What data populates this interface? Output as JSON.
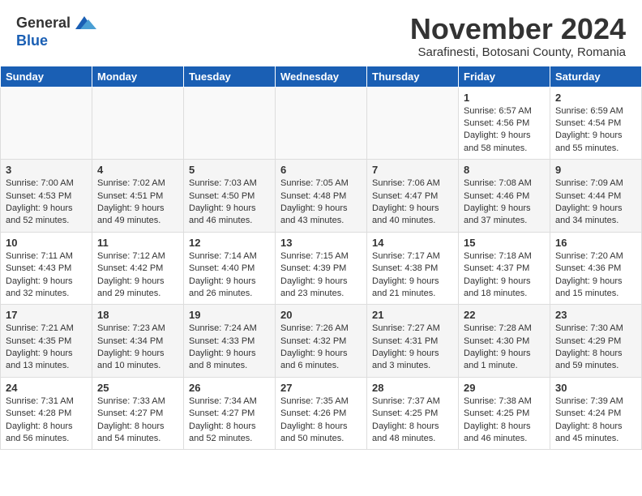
{
  "header": {
    "logo": {
      "general": "General",
      "blue": "Blue"
    },
    "title": "November 2024",
    "location": "Sarafinesti, Botosani County, Romania"
  },
  "calendar": {
    "days_of_week": [
      "Sunday",
      "Monday",
      "Tuesday",
      "Wednesday",
      "Thursday",
      "Friday",
      "Saturday"
    ],
    "weeks": [
      [
        {
          "day": "",
          "info": ""
        },
        {
          "day": "",
          "info": ""
        },
        {
          "day": "",
          "info": ""
        },
        {
          "day": "",
          "info": ""
        },
        {
          "day": "",
          "info": ""
        },
        {
          "day": "1",
          "info": "Sunrise: 6:57 AM\nSunset: 4:56 PM\nDaylight: 9 hours and 58 minutes."
        },
        {
          "day": "2",
          "info": "Sunrise: 6:59 AM\nSunset: 4:54 PM\nDaylight: 9 hours and 55 minutes."
        }
      ],
      [
        {
          "day": "3",
          "info": "Sunrise: 7:00 AM\nSunset: 4:53 PM\nDaylight: 9 hours and 52 minutes."
        },
        {
          "day": "4",
          "info": "Sunrise: 7:02 AM\nSunset: 4:51 PM\nDaylight: 9 hours and 49 minutes."
        },
        {
          "day": "5",
          "info": "Sunrise: 7:03 AM\nSunset: 4:50 PM\nDaylight: 9 hours and 46 minutes."
        },
        {
          "day": "6",
          "info": "Sunrise: 7:05 AM\nSunset: 4:48 PM\nDaylight: 9 hours and 43 minutes."
        },
        {
          "day": "7",
          "info": "Sunrise: 7:06 AM\nSunset: 4:47 PM\nDaylight: 9 hours and 40 minutes."
        },
        {
          "day": "8",
          "info": "Sunrise: 7:08 AM\nSunset: 4:46 PM\nDaylight: 9 hours and 37 minutes."
        },
        {
          "day": "9",
          "info": "Sunrise: 7:09 AM\nSunset: 4:44 PM\nDaylight: 9 hours and 34 minutes."
        }
      ],
      [
        {
          "day": "10",
          "info": "Sunrise: 7:11 AM\nSunset: 4:43 PM\nDaylight: 9 hours and 32 minutes."
        },
        {
          "day": "11",
          "info": "Sunrise: 7:12 AM\nSunset: 4:42 PM\nDaylight: 9 hours and 29 minutes."
        },
        {
          "day": "12",
          "info": "Sunrise: 7:14 AM\nSunset: 4:40 PM\nDaylight: 9 hours and 26 minutes."
        },
        {
          "day": "13",
          "info": "Sunrise: 7:15 AM\nSunset: 4:39 PM\nDaylight: 9 hours and 23 minutes."
        },
        {
          "day": "14",
          "info": "Sunrise: 7:17 AM\nSunset: 4:38 PM\nDaylight: 9 hours and 21 minutes."
        },
        {
          "day": "15",
          "info": "Sunrise: 7:18 AM\nSunset: 4:37 PM\nDaylight: 9 hours and 18 minutes."
        },
        {
          "day": "16",
          "info": "Sunrise: 7:20 AM\nSunset: 4:36 PM\nDaylight: 9 hours and 15 minutes."
        }
      ],
      [
        {
          "day": "17",
          "info": "Sunrise: 7:21 AM\nSunset: 4:35 PM\nDaylight: 9 hours and 13 minutes."
        },
        {
          "day": "18",
          "info": "Sunrise: 7:23 AM\nSunset: 4:34 PM\nDaylight: 9 hours and 10 minutes."
        },
        {
          "day": "19",
          "info": "Sunrise: 7:24 AM\nSunset: 4:33 PM\nDaylight: 9 hours and 8 minutes."
        },
        {
          "day": "20",
          "info": "Sunrise: 7:26 AM\nSunset: 4:32 PM\nDaylight: 9 hours and 6 minutes."
        },
        {
          "day": "21",
          "info": "Sunrise: 7:27 AM\nSunset: 4:31 PM\nDaylight: 9 hours and 3 minutes."
        },
        {
          "day": "22",
          "info": "Sunrise: 7:28 AM\nSunset: 4:30 PM\nDaylight: 9 hours and 1 minute."
        },
        {
          "day": "23",
          "info": "Sunrise: 7:30 AM\nSunset: 4:29 PM\nDaylight: 8 hours and 59 minutes."
        }
      ],
      [
        {
          "day": "24",
          "info": "Sunrise: 7:31 AM\nSunset: 4:28 PM\nDaylight: 8 hours and 56 minutes."
        },
        {
          "day": "25",
          "info": "Sunrise: 7:33 AM\nSunset: 4:27 PM\nDaylight: 8 hours and 54 minutes."
        },
        {
          "day": "26",
          "info": "Sunrise: 7:34 AM\nSunset: 4:27 PM\nDaylight: 8 hours and 52 minutes."
        },
        {
          "day": "27",
          "info": "Sunrise: 7:35 AM\nSunset: 4:26 PM\nDaylight: 8 hours and 50 minutes."
        },
        {
          "day": "28",
          "info": "Sunrise: 7:37 AM\nSunset: 4:25 PM\nDaylight: 8 hours and 48 minutes."
        },
        {
          "day": "29",
          "info": "Sunrise: 7:38 AM\nSunset: 4:25 PM\nDaylight: 8 hours and 46 minutes."
        },
        {
          "day": "30",
          "info": "Sunrise: 7:39 AM\nSunset: 4:24 PM\nDaylight: 8 hours and 45 minutes."
        }
      ]
    ]
  }
}
